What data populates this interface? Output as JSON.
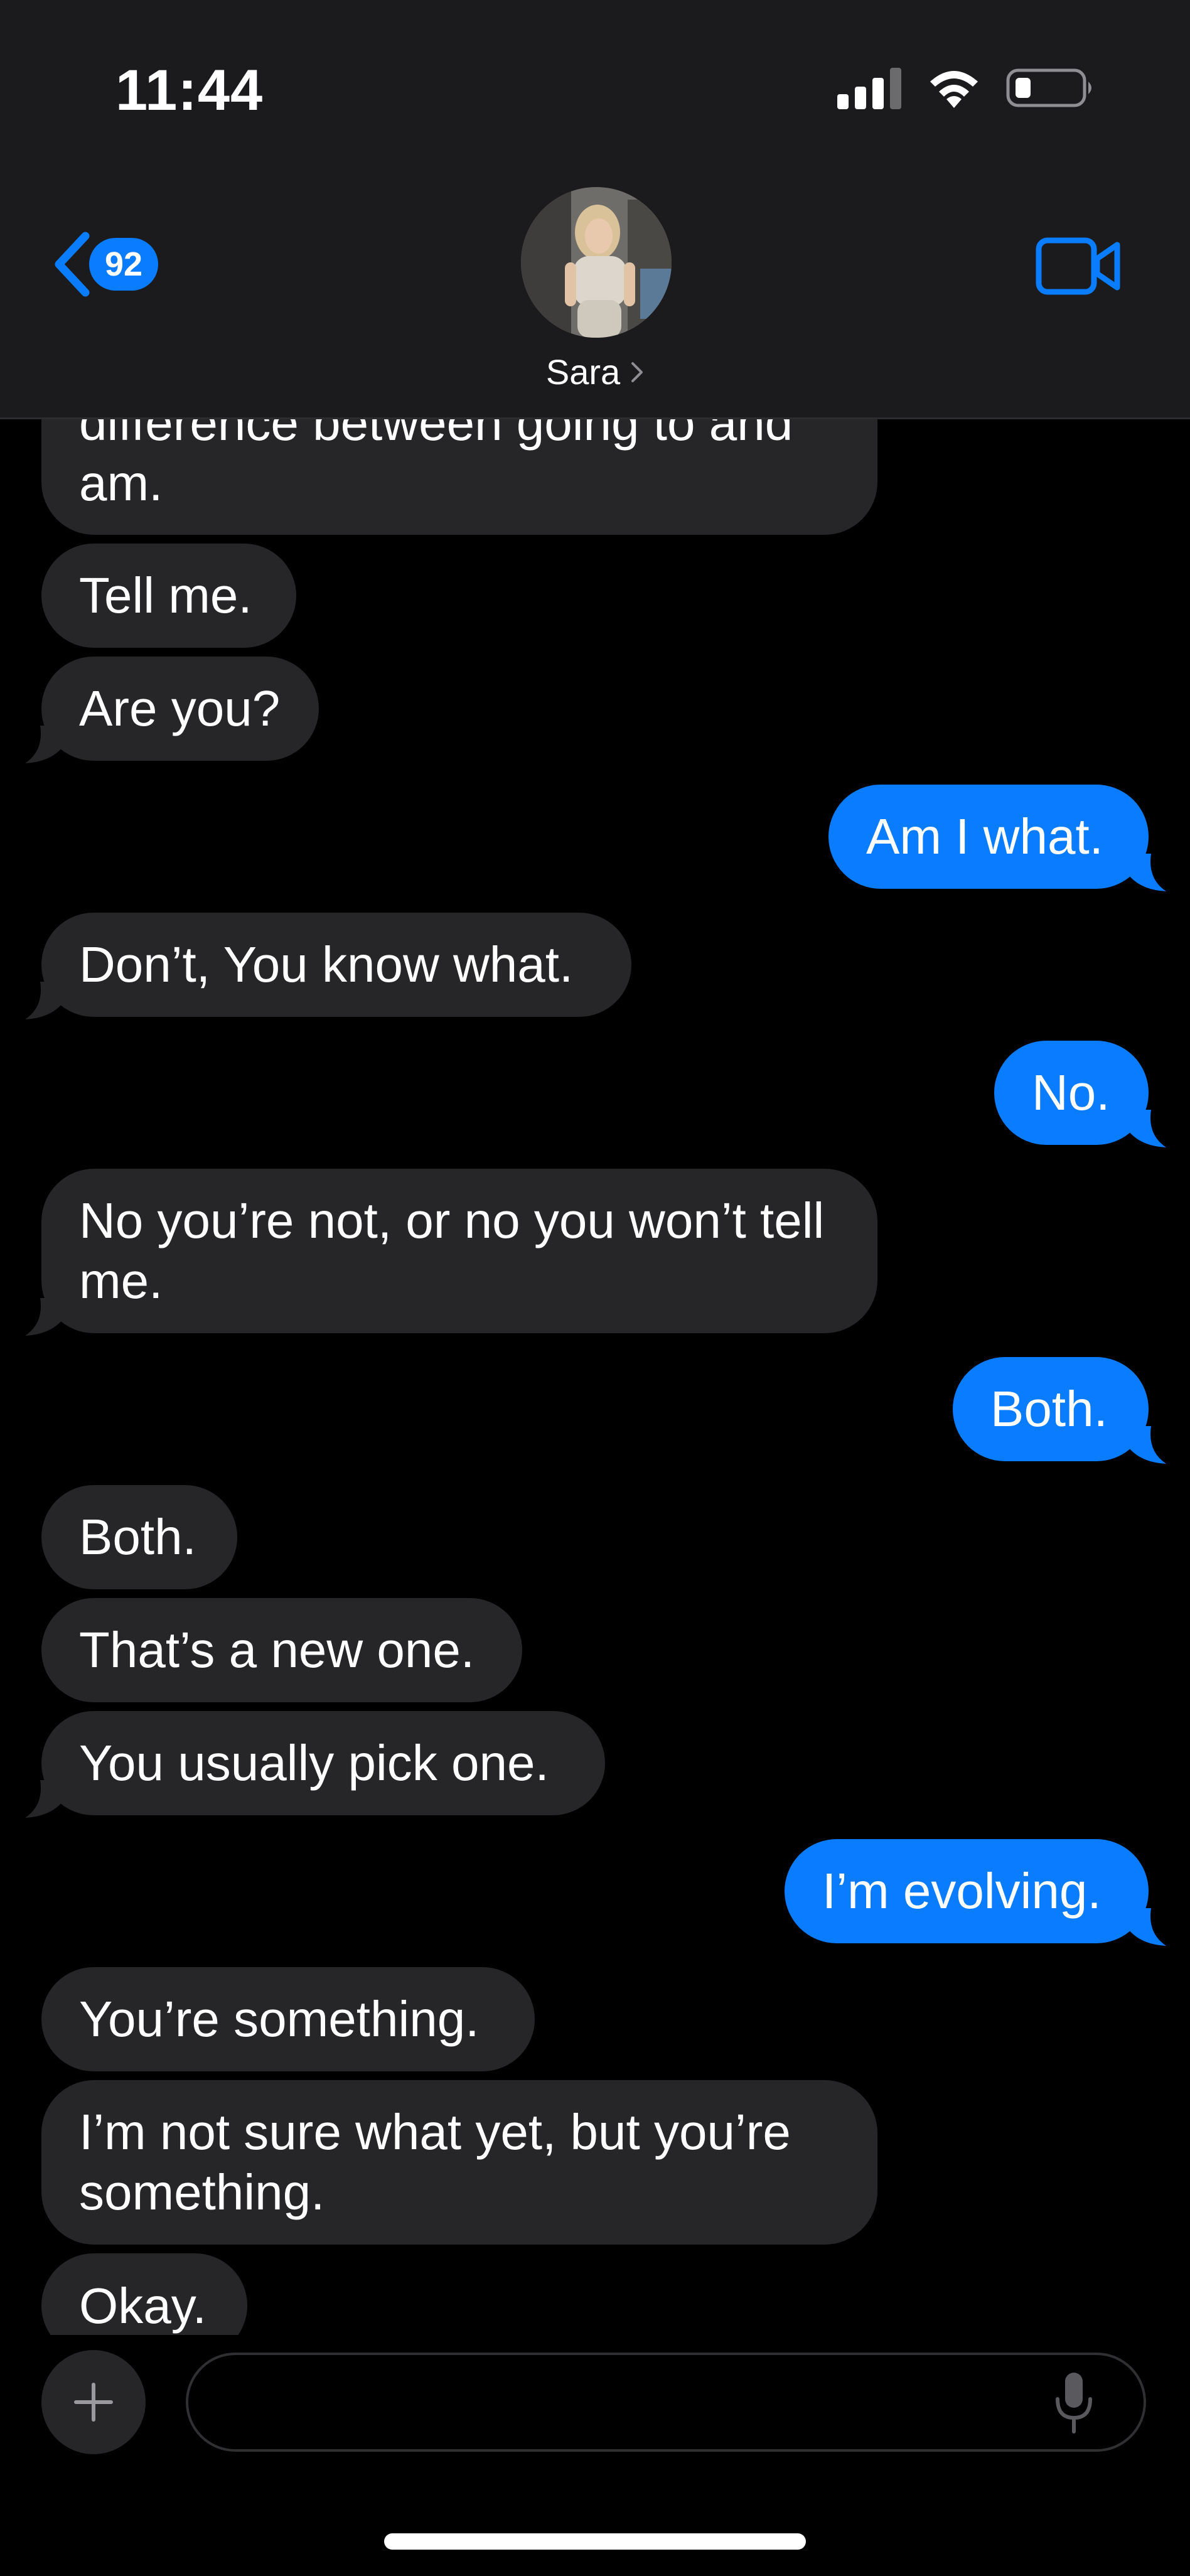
{
  "status_bar": {
    "time": "11:44"
  },
  "header": {
    "back_count": "92",
    "contact_name": "Sara"
  },
  "messages": [
    {
      "text": "difference between going to and am."
    },
    {
      "text": "Tell me."
    },
    {
      "text": "Are you?"
    },
    {
      "text": "Am I what."
    },
    {
      "text": "Don’t, You know what."
    },
    {
      "text": "No."
    },
    {
      "text": "No you’re not, or no you won’t tell me."
    },
    {
      "text": "Both."
    },
    {
      "text": "Both."
    },
    {
      "text": "That’s a new one."
    },
    {
      "text": "You usually pick one."
    },
    {
      "text": "I’m evolving."
    },
    {
      "text": "You’re something."
    },
    {
      "text": "I’m not sure what yet, but you’re something."
    },
    {
      "text": "Okay."
    }
  ],
  "composer": {
    "placeholder": ""
  },
  "colors": {
    "accent": "#0a7cff",
    "incoming_bubble": "#262628",
    "header_bg": "#1b1b1d"
  }
}
